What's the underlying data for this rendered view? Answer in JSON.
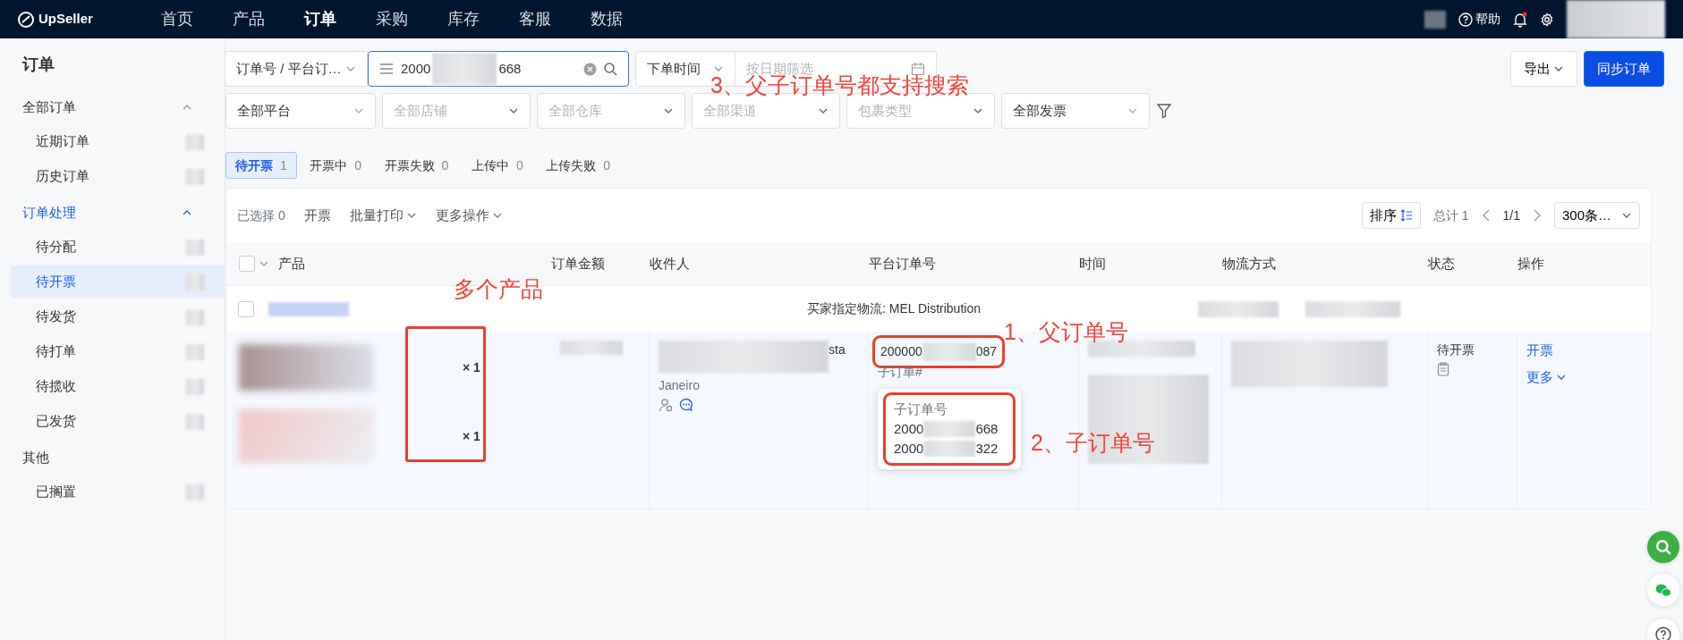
{
  "nav": {
    "logo": "UpSeller",
    "items": [
      {
        "label": "首页",
        "selected": false
      },
      {
        "label": "产品",
        "selected": false
      },
      {
        "label": "订单",
        "selected": true
      },
      {
        "label": "采购",
        "selected": false
      },
      {
        "label": "库存",
        "selected": false
      },
      {
        "label": "客服",
        "selected": false
      },
      {
        "label": "数据",
        "selected": false
      }
    ],
    "help": "帮助",
    "notification_dot": true
  },
  "sidebar": {
    "title": "订单",
    "groups": [
      {
        "label": "全部订单",
        "expanded": true,
        "selected": false,
        "children": [
          {
            "label": "近期订单",
            "selected": false
          },
          {
            "label": "历史订单",
            "selected": false
          }
        ]
      },
      {
        "label": "订单处理",
        "expanded": true,
        "selected": true,
        "children": [
          {
            "label": "待分配",
            "selected": false
          },
          {
            "label": "待开票",
            "selected": true
          },
          {
            "label": "待发货",
            "selected": false
          },
          {
            "label": "待打单",
            "selected": false
          },
          {
            "label": "待揽收",
            "selected": false
          },
          {
            "label": "已发货",
            "selected": false
          }
        ]
      },
      {
        "label": "其他",
        "selected": false,
        "children": [
          {
            "label": "已搁置",
            "selected": false
          }
        ]
      }
    ]
  },
  "filters": {
    "search_type": "订单号 / 平台订…",
    "search_prefix": "2000",
    "search_suffix": "668",
    "time_type": "下单时间",
    "date": {
      "placeholder": "按日期筛选"
    },
    "selects": [
      {
        "value": "全部平台"
      },
      {
        "placeholder": "全部店铺"
      },
      {
        "placeholder": "全部仓库"
      },
      {
        "placeholder": "全部渠道"
      },
      {
        "placeholder": "包裹类型"
      },
      {
        "value": "全部发票"
      }
    ],
    "export": "导出",
    "sync": "同步订单"
  },
  "status_tabs": [
    {
      "label": "待开票",
      "count": "1",
      "selected": true
    },
    {
      "label": "开票中",
      "count": "0",
      "selected": false
    },
    {
      "label": "开票失败",
      "count": "0",
      "selected": false
    },
    {
      "label": "上传中",
      "count": "0",
      "selected": false
    },
    {
      "label": "上传失败",
      "count": "0",
      "selected": false
    }
  ],
  "toolbar": {
    "selected_count": "已选择 0",
    "actions": [
      {
        "label": "开票",
        "dropdown": false
      },
      {
        "label": "批量打印",
        "dropdown": true
      },
      {
        "label": "更多操作",
        "dropdown": true
      }
    ],
    "sort": "排序",
    "total": "总计 1",
    "page": "1/1",
    "page_size": "300条…"
  },
  "table": {
    "columns": [
      "产品",
      "订单金额",
      "收件人",
      "平台订单号",
      "时间",
      "物流方式",
      "状态",
      "操作"
    ],
    "select_all_checked": false,
    "group_row": {
      "checked": false,
      "logistics_note": "买家指定物流: MEL Distribution"
    },
    "order": {
      "products": [
        {
          "qty": "× 1"
        },
        {
          "qty": "× 1"
        }
      ],
      "receiver": {
        "name_end": "sta",
        "city": "Janeiro"
      },
      "order_no_prefix": "200000",
      "order_no_suffix": "087",
      "child_label": "子订单#",
      "child_popover": {
        "title": "子订单号",
        "items": [
          {
            "prefix": "2000",
            "suffix": "668"
          },
          {
            "prefix": "2000",
            "suffix": "322"
          }
        ]
      },
      "status": "待开票",
      "actions": [
        {
          "label": "开票",
          "dropdown": false
        },
        {
          "label": "更多",
          "dropdown": true
        }
      ]
    }
  },
  "annotations": [
    {
      "text": "3、父子订单号都支持搜索"
    },
    {
      "text": "多个产品"
    },
    {
      "text": "1、父订单号"
    },
    {
      "text": "2、子订单号"
    }
  ]
}
